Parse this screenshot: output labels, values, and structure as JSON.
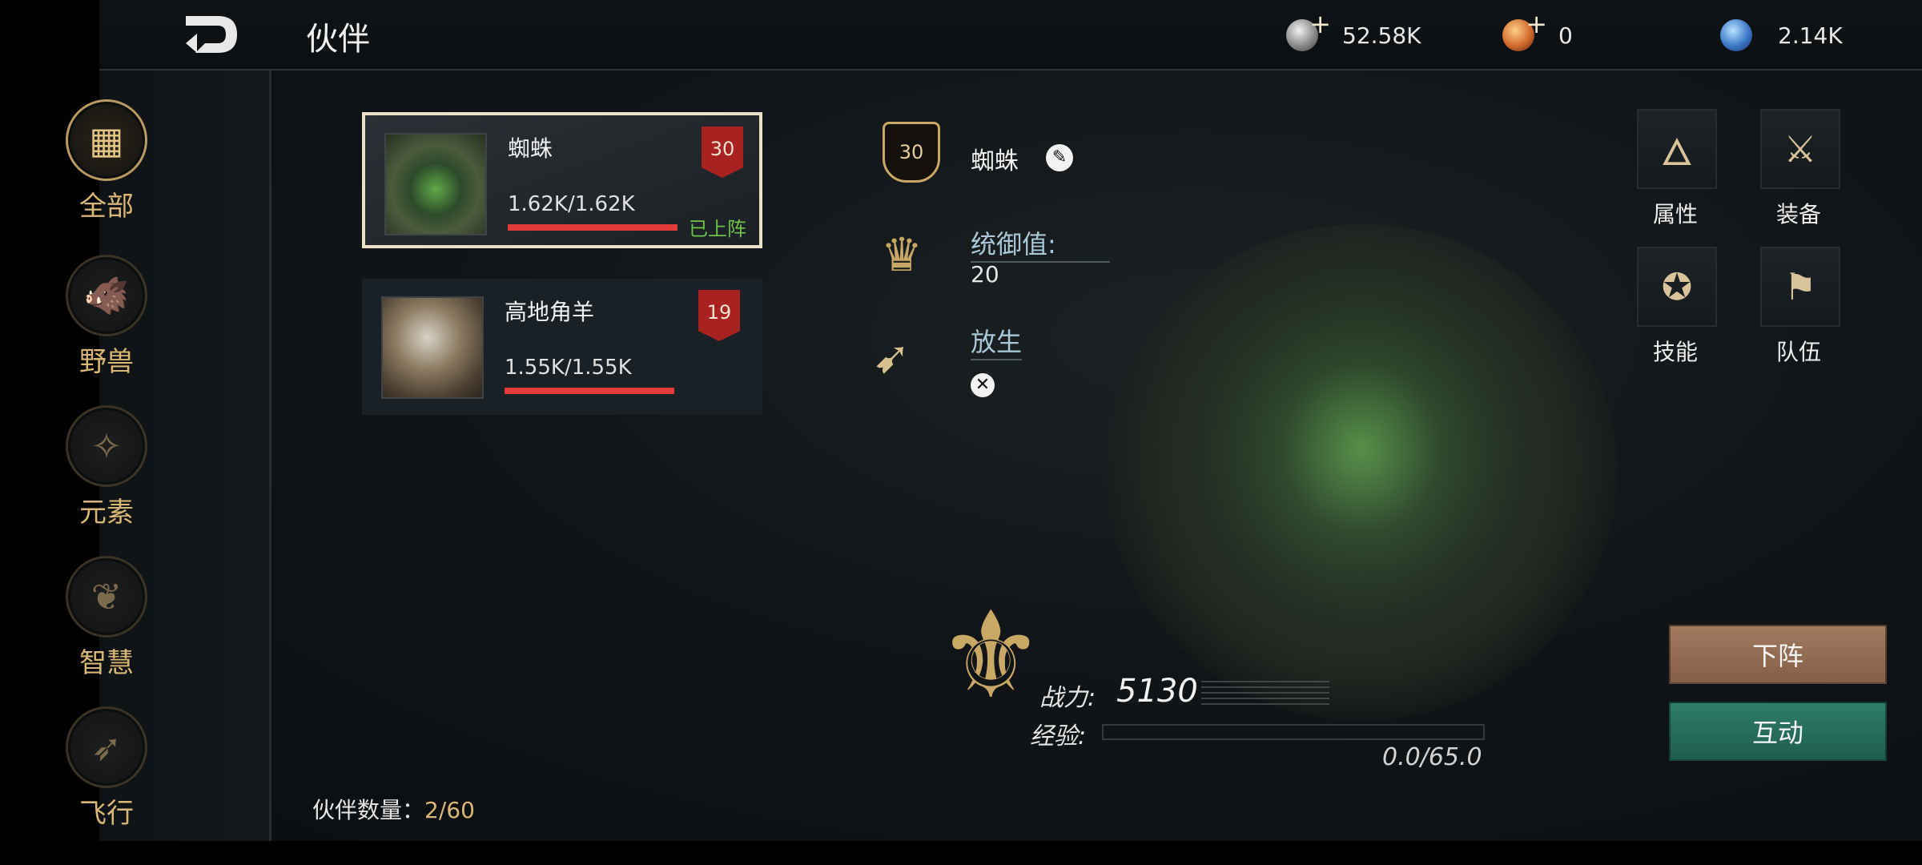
{
  "header": {
    "title": "伙伴",
    "resources": [
      {
        "icon": "silver-coin-icon",
        "value": "52.58K",
        "addable": true
      },
      {
        "icon": "copper-medal-icon",
        "value": "0",
        "addable": true
      },
      {
        "icon": "blue-gem-icon",
        "value": "2.14K",
        "addable": false
      }
    ],
    "plus": "+"
  },
  "categories": [
    {
      "label": "全部",
      "icon": "grid-icon",
      "glyph": "▦",
      "active": true
    },
    {
      "label": "野兽",
      "icon": "beast-head-icon",
      "glyph": "🐗",
      "active": false
    },
    {
      "label": "元素",
      "icon": "fairy-icon",
      "glyph": "✧",
      "active": false
    },
    {
      "label": "智慧",
      "icon": "owl-icon",
      "glyph": "❦",
      "active": false
    },
    {
      "label": "飞行",
      "icon": "wing-icon",
      "glyph": "➶",
      "active": false
    }
  ],
  "companions": [
    {
      "name": "蜘蛛",
      "hp": "1.62K/1.62K",
      "hp_fraction": 1.0,
      "level": "30",
      "status": "已上阵",
      "selected": true
    },
    {
      "name": "高地角羊",
      "hp": "1.55K/1.55K",
      "hp_fraction": 1.0,
      "level": "19",
      "status": "",
      "selected": false
    }
  ],
  "companion_count": {
    "label": "伙伴数量：",
    "value": "2/60"
  },
  "detail": {
    "level": "30",
    "name": "蜘蛛",
    "leadership_label": "统御值:",
    "leadership_value": "20",
    "release_label": "放生",
    "power_label": "战力:",
    "power_value": "5130",
    "exp_label": "经验:",
    "exp_value": "0.0/65.0",
    "exp_fraction": 0.0
  },
  "tabs": [
    {
      "label": "属性",
      "icon": "flame-icon",
      "glyph": "🜂"
    },
    {
      "label": "装备",
      "icon": "crossed-swords-icon",
      "glyph": "⚔"
    },
    {
      "label": "技能",
      "icon": "skill-icon",
      "glyph": "✪"
    },
    {
      "label": "队伍",
      "icon": "flag-icon",
      "glyph": "⚑"
    }
  ],
  "actions": {
    "undeploy": "下阵",
    "interact": "互动"
  },
  "colors": {
    "gold": "#d9b774",
    "deployed": "#6fc24a",
    "hp": "#e13a3a",
    "undeploy": "#a07b60",
    "interact": "#2f7d68"
  }
}
